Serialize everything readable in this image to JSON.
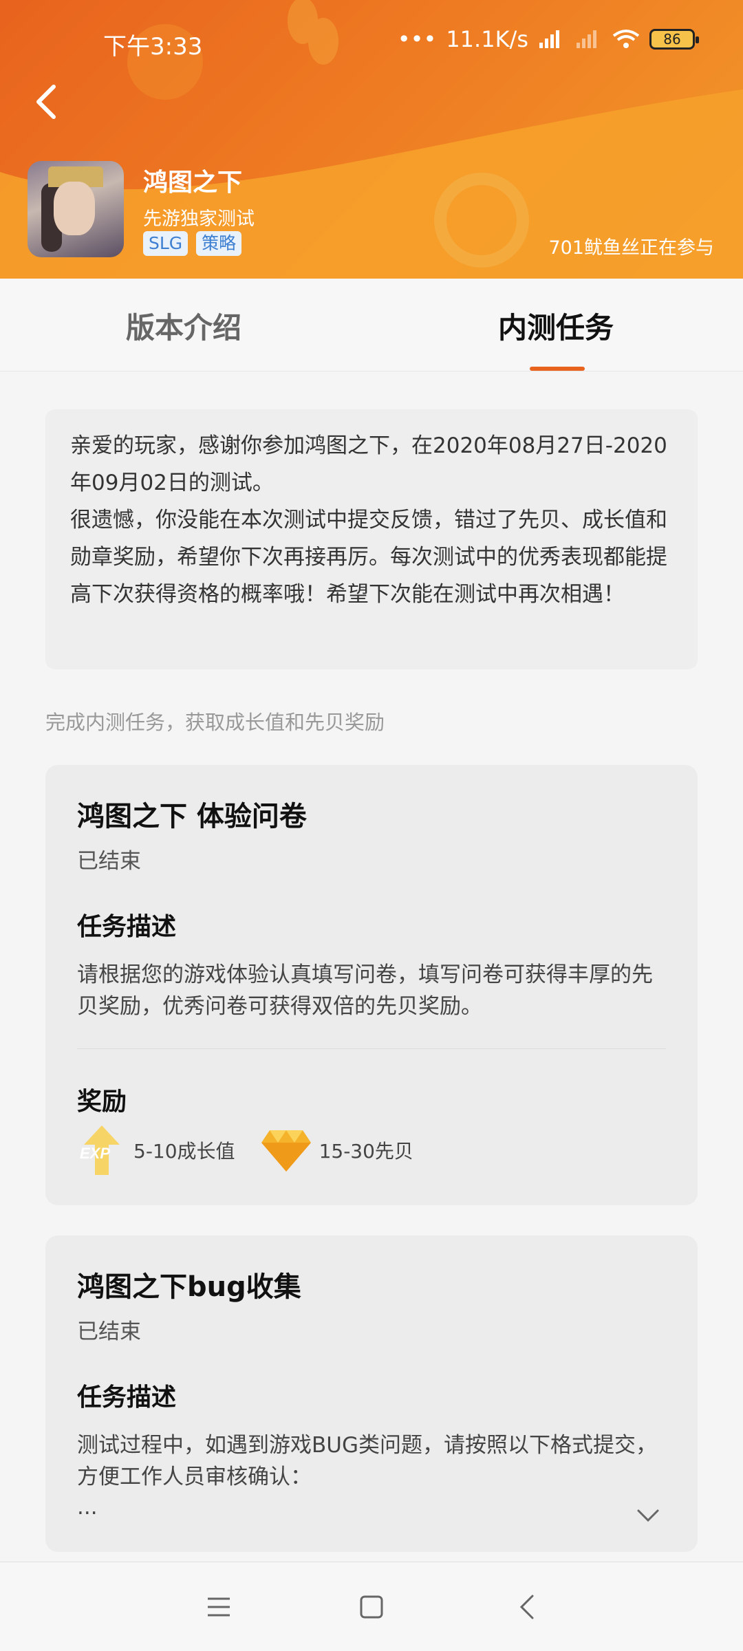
{
  "status_bar": {
    "time": "下午3:33",
    "network_speed": "11.1K/s",
    "battery": "86"
  },
  "header": {
    "game_title": "鸿图之下",
    "subtitle": "先游独家测试",
    "tags": [
      "SLG",
      "策略"
    ],
    "participants": "701鱿鱼丝正在参与"
  },
  "tabs": [
    {
      "label": "版本介绍",
      "active": false
    },
    {
      "label": "内测任务",
      "active": true
    }
  ],
  "notice": {
    "line1": "亲爱的玩家，感谢你参加鸿图之下，在2020年08月27日-2020年09月02日的测试。",
    "line2": "很遗憾，你没能在本次测试中提交反馈，错过了先贝、成长值和勋章奖励，希望你下次再接再厉。每次测试中的优秀表现都能提高下次获得资格的概率哦！希望下次能在测试中再次相遇！"
  },
  "tasks_subhead": "完成内测任务，获取成长值和先贝奖励",
  "tasks": [
    {
      "title": "鸿图之下 体验问卷",
      "status": "已结束",
      "desc_heading": "任务描述",
      "description": "请根据您的游戏体验认真填写问卷，填写问卷可获得丰厚的先贝奖励，优秀问卷可获得双倍的先贝奖励。",
      "reward_heading": "奖励",
      "rewards": [
        {
          "icon": "exp-icon",
          "text": "5-10成长值"
        },
        {
          "icon": "diamond-icon",
          "text": "15-30先贝"
        }
      ]
    },
    {
      "title": "鸿图之下bug收集",
      "status": "已结束",
      "desc_heading": "任务描述",
      "description": "测试过程中，如遇到游戏BUG类问题，请按照以下格式提交，方便工作人员审核确认：",
      "ellipsis": "..."
    }
  ],
  "colors": {
    "brand_orange": "#e8631e",
    "tag_blue": "#3d7fd1"
  }
}
